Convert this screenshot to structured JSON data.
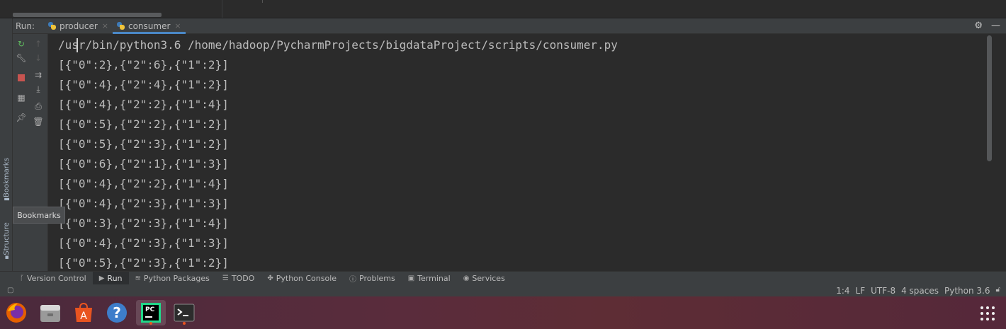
{
  "run_panel": {
    "label": "Run:",
    "tabs": [
      {
        "label": "producer",
        "active": false
      },
      {
        "label": "consumer",
        "active": true
      }
    ]
  },
  "console": {
    "lines": [
      "/usr/bin/python3.6 /home/hadoop/PycharmProjects/bigdataProject/scripts/consumer.py",
      "[{\"0\":2},{\"2\":6},{\"1\":2}]",
      "[{\"0\":4},{\"2\":4},{\"1\":2}]",
      "[{\"0\":4},{\"2\":2},{\"1\":4}]",
      "[{\"0\":5},{\"2\":2},{\"1\":2}]",
      "[{\"0\":5},{\"2\":3},{\"1\":2}]",
      "[{\"0\":6},{\"2\":1},{\"1\":3}]",
      "[{\"0\":4},{\"2\":2},{\"1\":4}]",
      "[{\"0\":4},{\"2\":3},{\"1\":3}]",
      "[{\"0\":3},{\"2\":3},{\"1\":4}]",
      "[{\"0\":4},{\"2\":3},{\"1\":3}]",
      "[{\"0\":5},{\"2\":3},{\"1\":2}]"
    ]
  },
  "side_stripe": {
    "bookmarks": "Bookmarks",
    "structure": "Structure"
  },
  "tooltip": "Bookmarks",
  "tool_windows": [
    {
      "label": "Version Control",
      "icon": "branch-icon"
    },
    {
      "label": "Run",
      "icon": "run-icon",
      "active": true
    },
    {
      "label": "Python Packages",
      "icon": "layers-icon"
    },
    {
      "label": "TODO",
      "icon": "list-icon"
    },
    {
      "label": "Python Console",
      "icon": "python-icon"
    },
    {
      "label": "Problems",
      "icon": "info-icon"
    },
    {
      "label": "Terminal",
      "icon": "terminal-icon"
    },
    {
      "label": "Services",
      "icon": "services-icon"
    }
  ],
  "status": {
    "position": "1:4",
    "line_sep": "LF",
    "encoding": "UTF-8",
    "indent": "4 spaces",
    "interpreter": "Python 3.6"
  },
  "dock": {
    "apps": [
      "firefox-icon",
      "files-icon",
      "software-center-icon",
      "help-icon",
      "pycharm-icon",
      "terminal-icon"
    ],
    "pycharm_badge": "PC"
  },
  "colors": {
    "accent_tab": "#4a88c7",
    "stop_red": "#c75450",
    "rerun_green": "#5fb85f"
  }
}
